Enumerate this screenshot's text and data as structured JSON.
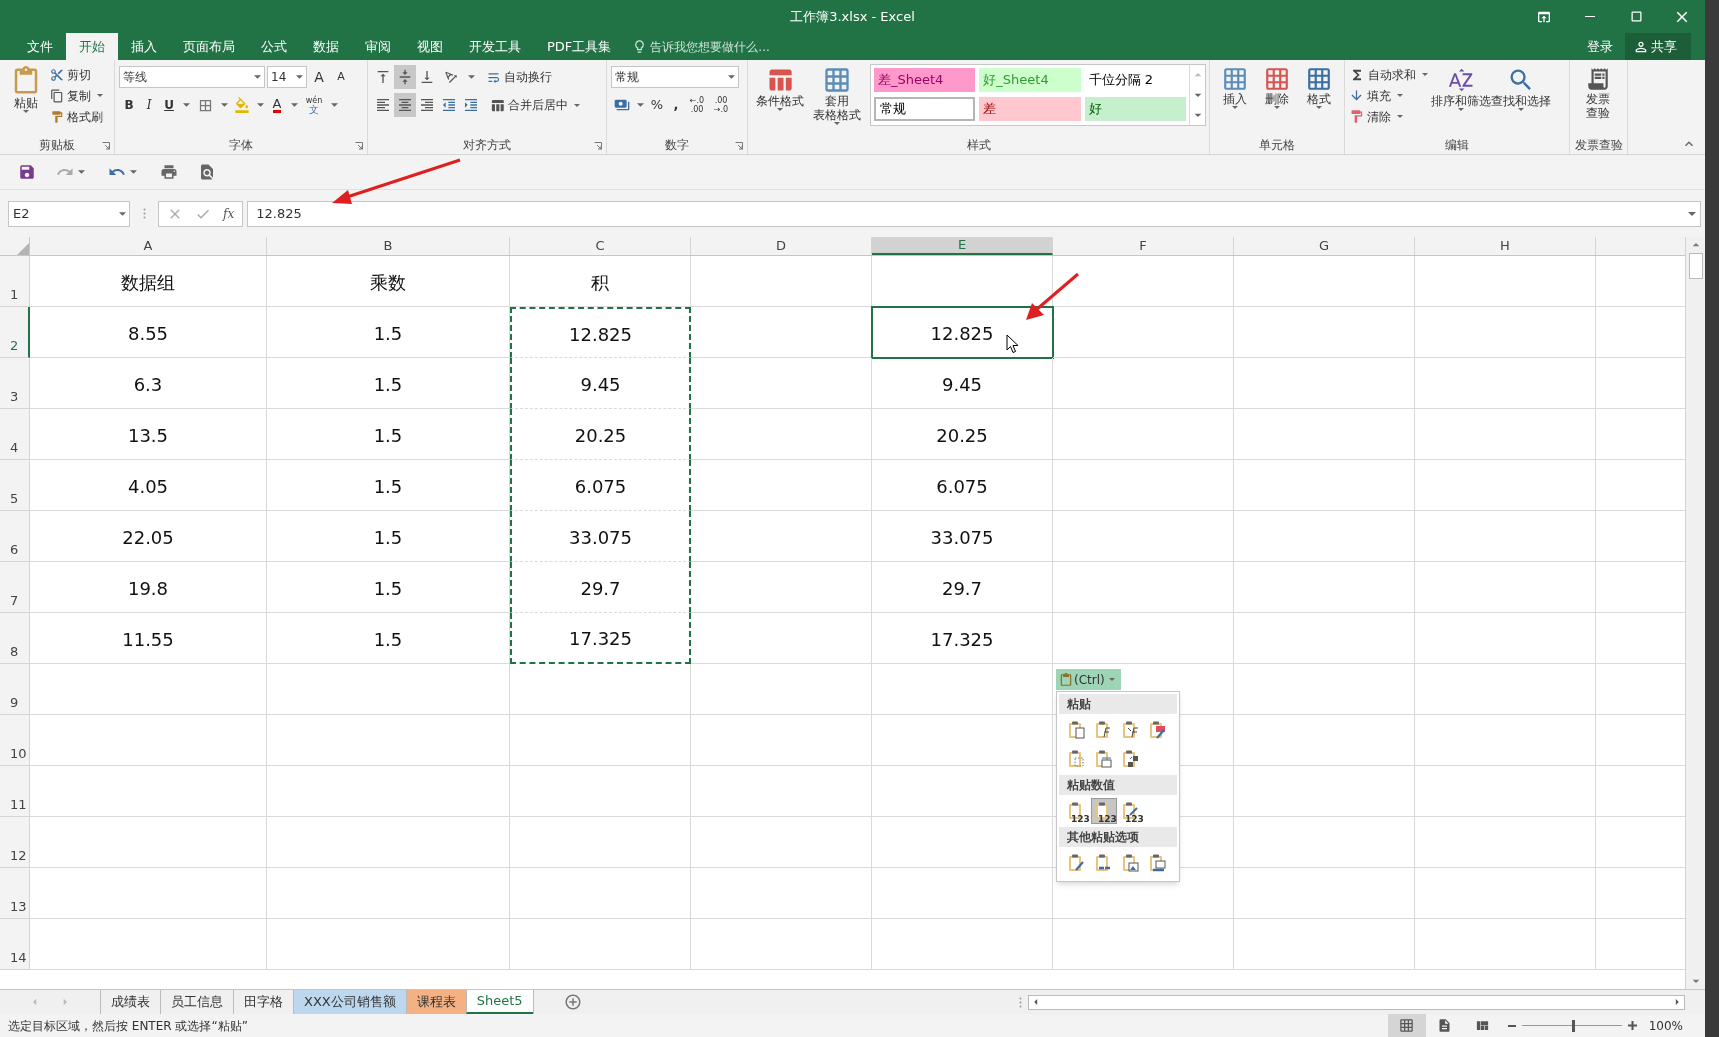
{
  "window": {
    "title": "工作簿3.xlsx - Excel"
  },
  "menu_tabs": [
    {
      "label": "文件",
      "selected": false
    },
    {
      "label": "开始",
      "selected": true
    },
    {
      "label": "插入",
      "selected": false
    },
    {
      "label": "页面布局",
      "selected": false
    },
    {
      "label": "公式",
      "selected": false
    },
    {
      "label": "数据",
      "selected": false
    },
    {
      "label": "审阅",
      "selected": false
    },
    {
      "label": "视图",
      "selected": false
    },
    {
      "label": "开发工具",
      "selected": false
    },
    {
      "label": "PDF工具集",
      "selected": false
    }
  ],
  "tell_me": {
    "placeholder": "告诉我您想要做什么..."
  },
  "account": {
    "login": "登录",
    "share": "共享"
  },
  "clipboard": {
    "paste": "粘贴",
    "cut": "剪切",
    "copy": "复制",
    "format_painter": "格式刷",
    "label": "剪贴板"
  },
  "font": {
    "name": "等线",
    "size": "14",
    "grow": "A",
    "shrink": "A",
    "bold": "B",
    "italic": "I",
    "underline": "U",
    "font_color": "A",
    "phonetic": [
      "wén",
      "文"
    ],
    "label": "字体"
  },
  "alignment": {
    "wrap": "自动换行",
    "merge": "合并后居中",
    "label": "对齐方式"
  },
  "number": {
    "format": "常规",
    "percent": "%",
    "comma": ",",
    "increase_decimal": [
      "←.0",
      ".00"
    ],
    "decrease_decimal": [
      ".00",
      "→.0"
    ],
    "label": "数字"
  },
  "styles": {
    "conditional": "条件格式",
    "table": [
      "套用",
      "表格格式"
    ],
    "label": "样式",
    "gallery": [
      {
        "label": "差_Sheet4",
        "color": "#ff99cc",
        "kind": "bad_custom",
        "selected": false
      },
      {
        "label": "好_Sheet4",
        "color": "#ccffcc",
        "kind": "good_custom",
        "selected": false
      },
      {
        "label": "千位分隔 2",
        "color": "#ffffff",
        "kind": "plain",
        "selected": false
      },
      {
        "label": "常规",
        "color": "#ffffff",
        "kind": "plain",
        "selected": true
      },
      {
        "label": "差",
        "color": "#ffc7ce",
        "kind": "bad",
        "selected": false
      },
      {
        "label": "好",
        "color": "#c6efce",
        "kind": "good",
        "selected": false
      }
    ]
  },
  "cells_group": {
    "insert": "插入",
    "delete": "删除",
    "format": "格式",
    "label": "单元格"
  },
  "editing": {
    "autosum": "自动求和",
    "fill": "填充",
    "clear": "清除",
    "sort": "排序和筛选",
    "find": "查找和选择",
    "label": "编辑"
  },
  "invoice": {
    "button": [
      "发票",
      "查验"
    ],
    "label": "发票查验"
  },
  "formula_bar": {
    "name_box": "E2",
    "function_label": "fx",
    "value": "12.825"
  },
  "column_headers": [
    {
      "label": "A",
      "selected": false
    },
    {
      "label": "B",
      "selected": false
    },
    {
      "label": "C",
      "selected": false
    },
    {
      "label": "D",
      "selected": false
    },
    {
      "label": "E",
      "selected": true
    },
    {
      "label": "F",
      "selected": false
    },
    {
      "label": "G",
      "selected": false
    },
    {
      "label": "H",
      "selected": false
    }
  ],
  "row_headers": [
    {
      "label": "1",
      "selected": false
    },
    {
      "label": "2",
      "selected": true
    },
    {
      "label": "3",
      "selected": false
    },
    {
      "label": "4",
      "selected": false
    },
    {
      "label": "5",
      "selected": false
    },
    {
      "label": "6",
      "selected": false
    },
    {
      "label": "7",
      "selected": false
    },
    {
      "label": "8",
      "selected": false
    },
    {
      "label": "9",
      "selected": false
    },
    {
      "label": "10",
      "selected": false
    },
    {
      "label": "11",
      "selected": false
    },
    {
      "label": "12",
      "selected": false
    },
    {
      "label": "13",
      "selected": false
    },
    {
      "label": "14",
      "selected": false
    }
  ],
  "rows": [
    {
      "A": {
        "text": "数据组"
      },
      "B": {
        "text": "乘数"
      },
      "C": {
        "text": "积"
      }
    },
    {
      "A": {
        "text": "8.55"
      },
      "B": {
        "text": "1.5"
      },
      "C": {
        "text": "12.825",
        "copied": true
      },
      "E": {
        "text": "12.825",
        "selected": true
      }
    },
    {
      "A": {
        "text": "6.3"
      },
      "B": {
        "text": "1.5"
      },
      "C": {
        "text": "9.45",
        "copied": true
      },
      "E": {
        "text": "9.45"
      }
    },
    {
      "A": {
        "text": "13.5"
      },
      "B": {
        "text": "1.5"
      },
      "C": {
        "text": "20.25",
        "copied": true
      },
      "E": {
        "text": "20.25"
      }
    },
    {
      "A": {
        "text": "4.05"
      },
      "B": {
        "text": "1.5"
      },
      "C": {
        "text": "6.075",
        "copied": true
      },
      "E": {
        "text": "6.075"
      }
    },
    {
      "A": {
        "text": "22.05"
      },
      "B": {
        "text": "1.5"
      },
      "C": {
        "text": "33.075",
        "copied": true
      },
      "E": {
        "text": "33.075"
      }
    },
    {
      "A": {
        "text": "19.8"
      },
      "B": {
        "text": "1.5"
      },
      "C": {
        "text": "29.7",
        "copied": true
      },
      "E": {
        "text": "29.7"
      }
    },
    {
      "A": {
        "text": "11.55"
      },
      "B": {
        "text": "1.5"
      },
      "C": {
        "text": "17.325",
        "copied": true
      },
      "E": {
        "text": "17.325"
      }
    }
  ],
  "paste_options": {
    "button": "(Ctrl)",
    "sections": [
      {
        "title": "粘贴",
        "options": [
          {
            "kind": "all"
          },
          {
            "kind": "formula"
          },
          {
            "kind": "formula_number"
          },
          {
            "kind": "keep_format"
          },
          {
            "kind": "no_border"
          },
          {
            "kind": "keep_width"
          },
          {
            "kind": "transpose"
          }
        ]
      },
      {
        "title": "粘贴数值",
        "options": [
          {
            "kind": "values",
            "caption": "123",
            "selected": false
          },
          {
            "kind": "values_number",
            "caption": "123",
            "selected": true
          },
          {
            "kind": "values_format",
            "caption": "123",
            "selected": false
          }
        ]
      },
      {
        "title": "其他粘贴选项",
        "options": [
          {
            "kind": "formatting"
          },
          {
            "kind": "link"
          },
          {
            "kind": "picture"
          },
          {
            "kind": "linked_picture"
          }
        ]
      }
    ]
  },
  "sheet_tabs": [
    {
      "label": "成绩表",
      "selected": false
    },
    {
      "label": "员工信息",
      "selected": false
    },
    {
      "label": "田字格",
      "selected": false
    },
    {
      "label": "XXX公司销售额",
      "color": "#bdd7ee",
      "selected": false
    },
    {
      "label": "课程表",
      "color": "#f4b183",
      "selected": false
    },
    {
      "label": "Sheet5",
      "selected": true
    }
  ],
  "status_bar": {
    "message": "选定目标区域，然后按 ENTER 或选择“粘贴”",
    "zoom": {
      "level": 0.5,
      "reading": "100%"
    }
  }
}
